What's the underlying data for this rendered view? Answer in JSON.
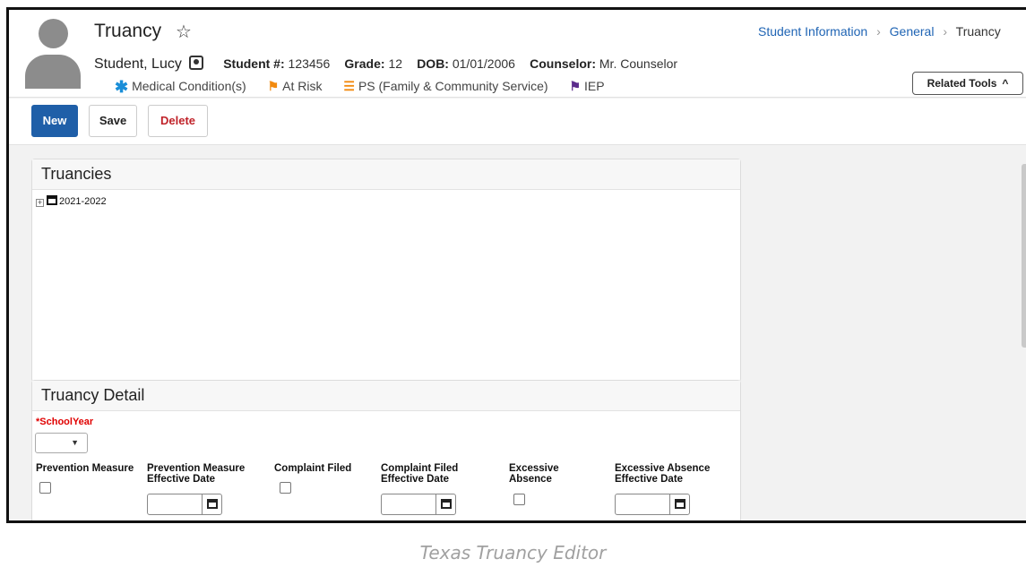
{
  "header": {
    "title": "Truancy",
    "favorite_icon": "star-outline-icon",
    "student_name": "Student, Lucy",
    "student_number_label": "Student #:",
    "student_number": "123456",
    "grade_label": "Grade:",
    "grade": "12",
    "dob_label": "DOB:",
    "dob": "01/01/2006",
    "counselor_label": "Counselor:",
    "counselor": "Mr. Counselor",
    "flags": [
      {
        "label": "Medical Condition(s)",
        "icon": "asterisk-icon",
        "color": "#1a8ed8"
      },
      {
        "label": "At Risk",
        "icon": "flag-icon",
        "color": "#f28a0f"
      },
      {
        "label": "PS (Family & Community Service)",
        "icon": "list-icon",
        "color": "#f28a0f"
      },
      {
        "label": "IEP",
        "icon": "flag-icon",
        "color": "#5b2b8c"
      }
    ],
    "breadcrumb": [
      "Student Information",
      "General",
      "Truancy"
    ],
    "related_tools": "Related Tools"
  },
  "toolbar": {
    "new_label": "New",
    "save_label": "Save",
    "delete_label": "Delete"
  },
  "truancies": {
    "title": "Truancies",
    "tree": [
      {
        "label": "2021-2022"
      }
    ]
  },
  "detail": {
    "title": "Truancy Detail",
    "school_year_label": "*SchoolYear",
    "school_year_value": "",
    "fields": {
      "prevention_measure": "Prevention Measure",
      "prevention_measure_date_1": "Prevention Measure",
      "prevention_measure_date_2": "Effective Date",
      "complaint_filed": "Complaint Filed",
      "complaint_filed_date_1": "Complaint Filed",
      "complaint_filed_date_2": "Effective Date",
      "excessive_absence_1": "Excessive",
      "excessive_absence_2": "Absence",
      "excessive_absence_date_1": "Excessive Absence",
      "excessive_absence_date_2": "Effective Date"
    }
  },
  "caption": "Texas Truancy Editor",
  "colors": {
    "primary_button": "#1f5fa8",
    "delete_text": "#c0232a",
    "link": "#1f64b4",
    "required": "#e00000"
  }
}
